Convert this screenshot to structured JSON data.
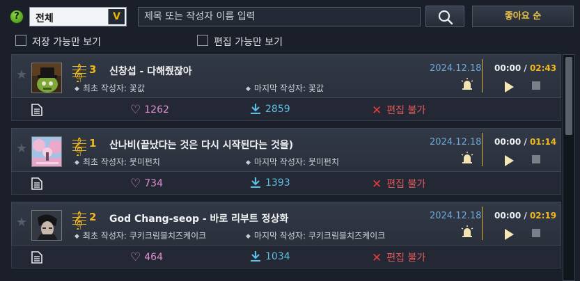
{
  "toolbar": {
    "help_label": "?",
    "category_value": "전체",
    "search_placeholder": "제목 또는 작성자 이름 입력",
    "sort_label": "좋아요 순"
  },
  "filters": [
    {
      "label": "저장 가능만 보기",
      "checked": false
    },
    {
      "label": "편집 가능만 보기",
      "checked": false
    }
  ],
  "songs": [
    {
      "rank": "3",
      "title": "신창섭 - 다해줬잖아",
      "creator_label": "최초 작성자: 꽃값",
      "last_editor_label": "마지막 작성자: 꽃값",
      "date": "2024.12.18",
      "current_time": "00:00",
      "total_time": "02:43",
      "likes": "1262",
      "downloads": "2859",
      "edit_status": "편집 불가"
    },
    {
      "rank": "1",
      "title": "산나비(끝났다는 것은 다시 시작된다는 것을)",
      "creator_label": "최초 작성자: 붓미펀치",
      "last_editor_label": "마지막 작성자: 붓미펀치",
      "date": "2024.12.18",
      "current_time": "00:00",
      "total_time": "01:14",
      "likes": "734",
      "downloads": "1393",
      "edit_status": "편집 불가"
    },
    {
      "rank": "2",
      "title": "God Chang-seop - 바로 리부트 정상화",
      "creator_label": "최초 작성자: 쿠키크림블치즈케이크",
      "last_editor_label": "마지막 작성자: 쿠키크림블치즈케이크",
      "date": "2024.12.18",
      "current_time": "00:00",
      "total_time": "02:19",
      "likes": "464",
      "downloads": "1034",
      "edit_status": "편집 불가"
    }
  ],
  "colors": {
    "accent_gold": "#f0b81a",
    "date_blue": "#6fa7d6",
    "like_pink": "#e28fd0",
    "download_cyan": "#5ebfe2",
    "no_edit_red": "#e35b5b"
  },
  "icons": [
    "help-icon",
    "chevron-down-icon",
    "search-icon",
    "star-icon",
    "treble-clef-icon",
    "alarm-icon",
    "play-icon",
    "stop-icon",
    "document-icon",
    "heart-icon",
    "download-icon",
    "close-icon"
  ]
}
